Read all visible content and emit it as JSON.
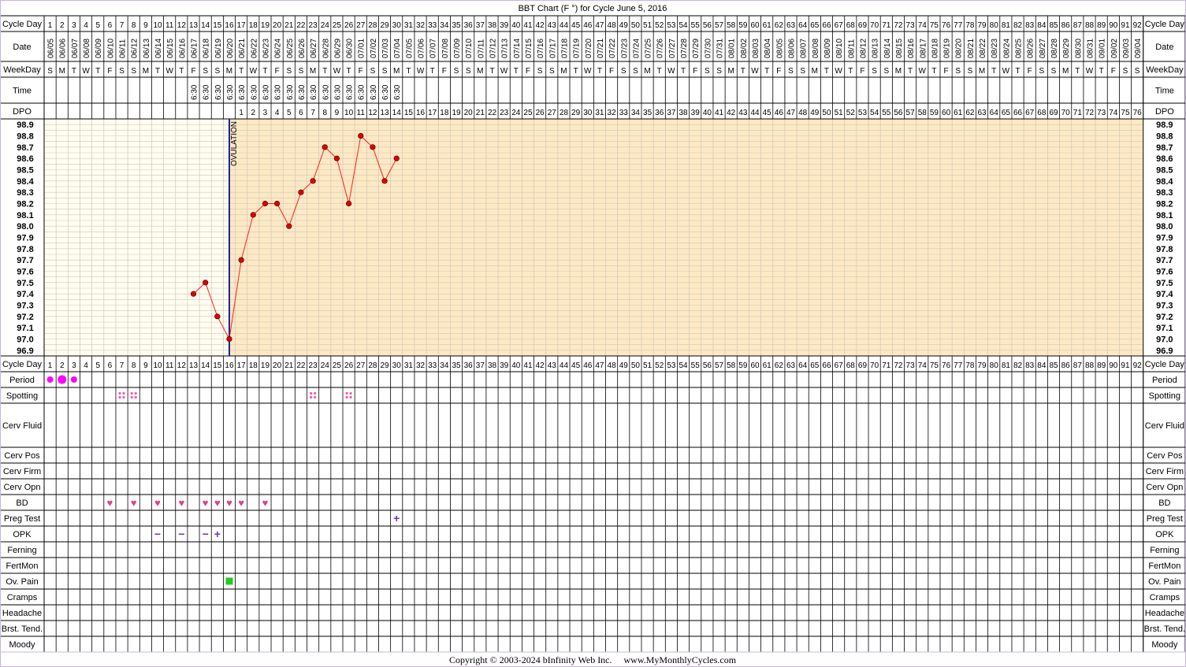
{
  "title": "BBT Chart (F °) for Cycle June 5, 2016",
  "copyright": "Copyright © 2003-2024 bInfinity Web Inc.     www.MyMonthlyCycles.com",
  "colors": {
    "border": "#c8b4e6",
    "pre_ovulation_bg": "#fffdf0",
    "post_ovulation_bg": "#fde9c4",
    "grid": "#cfc8b8",
    "temp_line": "#ff2020",
    "temp_point": "#e00000",
    "ovulation_line": "#2020a0",
    "period": "#ff00ff",
    "spotting": "#ff55aa",
    "bd_heart": "#e0408a",
    "test_mark": "#7030c0",
    "ov_pain": "#22cc22"
  },
  "labels": {
    "cycle_day": "Cycle Day",
    "date": "Date",
    "weekday": "WeekDay",
    "time": "Time",
    "dpo": "DPO",
    "ovulation": "OVULATION"
  },
  "symptom_rows": [
    "Period",
    "Spotting",
    "Cerv Fluid",
    "Cerv Pos",
    "Cerv Firm",
    "Cerv Opn",
    "BD",
    "Preg Test",
    "OPK",
    "Ferning",
    "FertMon",
    "Ov. Pain",
    "Cramps",
    "Headache",
    "Brst. Tend.",
    "Moody"
  ],
  "chart_data": {
    "type": "line",
    "title": "BBT Chart (F °) for Cycle June 5, 2016",
    "cycle_days": [
      1,
      2,
      3,
      4,
      5,
      6,
      7,
      8,
      9,
      10,
      11,
      12,
      13,
      14,
      15,
      16,
      17,
      18,
      19,
      20,
      21,
      22,
      23,
      24,
      25,
      26,
      27,
      28,
      29,
      30,
      31,
      32,
      33,
      34,
      35,
      36,
      37,
      38,
      39,
      40,
      41,
      42,
      43,
      44,
      45,
      46,
      47,
      48,
      49,
      50,
      51,
      52,
      53,
      54,
      55,
      56,
      57,
      58,
      59,
      60,
      61,
      62,
      63,
      64,
      65,
      66,
      67,
      68,
      69,
      70,
      71,
      72,
      73,
      74,
      75,
      76,
      77,
      78,
      79,
      80,
      81,
      82,
      83,
      84,
      85,
      86,
      87,
      88,
      89,
      90,
      91,
      92
    ],
    "dates": [
      "06/05",
      "06/06",
      "06/07",
      "06/08",
      "06/09",
      "06/10",
      "06/11",
      "06/12",
      "06/13",
      "06/14",
      "06/15",
      "06/16",
      "06/17",
      "06/18",
      "06/19",
      "06/20",
      "06/21",
      "06/22",
      "06/23",
      "06/24",
      "06/25",
      "06/26",
      "06/27",
      "06/28",
      "06/29",
      "06/30",
      "07/01",
      "07/02",
      "07/03",
      "07/04",
      "07/05",
      "07/06",
      "07/07",
      "07/08",
      "07/09",
      "07/10",
      "07/11",
      "07/12",
      "07/13",
      "07/14",
      "07/15",
      "07/16",
      "07/17",
      "07/18",
      "07/19",
      "07/20",
      "07/21",
      "07/22",
      "07/23",
      "07/24",
      "07/25",
      "07/26",
      "07/27",
      "07/28",
      "07/29",
      "07/30",
      "07/31",
      "08/01",
      "08/02",
      "08/03",
      "08/04",
      "08/05",
      "08/06",
      "08/07",
      "08/08",
      "08/09",
      "08/10",
      "08/11",
      "08/12",
      "08/13",
      "08/14",
      "08/15",
      "08/16",
      "08/17",
      "08/18",
      "08/19",
      "08/20",
      "08/21",
      "08/22",
      "08/23",
      "08/24",
      "08/25",
      "08/26",
      "08/27",
      "08/28",
      "08/29",
      "08/30",
      "08/31",
      "09/01",
      "09/02",
      "09/03",
      "09/04"
    ],
    "weekdays": [
      "S",
      "M",
      "T",
      "W",
      "T",
      "F",
      "S",
      "S",
      "M",
      "T",
      "W",
      "T",
      "F",
      "S",
      "S",
      "M",
      "T",
      "W",
      "T",
      "F",
      "S",
      "S",
      "M",
      "T",
      "W",
      "T",
      "F",
      "S",
      "S",
      "M",
      "T",
      "W",
      "T",
      "F",
      "S",
      "S",
      "M",
      "T",
      "W",
      "T",
      "F",
      "S",
      "S",
      "M",
      "T",
      "W",
      "T",
      "F",
      "S",
      "S",
      "M",
      "T",
      "W",
      "T",
      "F",
      "S",
      "S",
      "M",
      "T",
      "W",
      "T",
      "F",
      "S",
      "S",
      "M",
      "T",
      "W",
      "T",
      "F",
      "S",
      "S",
      "M",
      "T",
      "W",
      "T",
      "F",
      "S",
      "S",
      "M",
      "T",
      "W",
      "T",
      "F",
      "S",
      "S",
      "M",
      "T",
      "W",
      "T",
      "F",
      "S",
      "S"
    ],
    "times": [
      null,
      null,
      null,
      null,
      null,
      null,
      null,
      null,
      null,
      null,
      null,
      null,
      "6:30",
      "6:30",
      "6:30",
      "6:30",
      "6:30",
      "6:30",
      "6:30",
      "6:30",
      "6:30",
      "6:30",
      "6:30",
      "6:30",
      "6:30",
      "6:30",
      "6:30",
      "6:30",
      "6:30",
      "6:30"
    ],
    "dpo": [
      1,
      2,
      3,
      4,
      5,
      6,
      7,
      8,
      9,
      10,
      11,
      12,
      13,
      14,
      15,
      16,
      17,
      18,
      19,
      20,
      21,
      22,
      23,
      24,
      25,
      26,
      27,
      28,
      29,
      30,
      31,
      32,
      33,
      34,
      35,
      36,
      37,
      38,
      39,
      40,
      41,
      42,
      43,
      44,
      45,
      46,
      47,
      48,
      49,
      50,
      51,
      52,
      53,
      54,
      55,
      56,
      57,
      58,
      59,
      60,
      61,
      62,
      63,
      64,
      65,
      66,
      67,
      68,
      69,
      70,
      71,
      72,
      73,
      74,
      75,
      76
    ],
    "dpo_start_day": 17,
    "temp_axis_labels": [
      "98.9",
      "98.8",
      "98.7",
      "98.6",
      "98.5",
      "98.4",
      "98.3",
      "98.2",
      "98.1",
      "98.0",
      "97.9",
      "97.8",
      "97.7",
      "97.6",
      "97.5",
      "97.4",
      "97.3",
      "97.2",
      "97.1",
      "97.0",
      "96.9"
    ],
    "ylim": [
      96.9,
      98.9
    ],
    "temperatures": [
      {
        "day": 13,
        "temp": 97.4
      },
      {
        "day": 14,
        "temp": 97.5
      },
      {
        "day": 15,
        "temp": 97.2
      },
      {
        "day": 16,
        "temp": 97.0
      },
      {
        "day": 17,
        "temp": 97.7
      },
      {
        "day": 18,
        "temp": 98.1
      },
      {
        "day": 19,
        "temp": 98.2
      },
      {
        "day": 20,
        "temp": 98.2
      },
      {
        "day": 21,
        "temp": 98.0
      },
      {
        "day": 22,
        "temp": 98.3
      },
      {
        "day": 23,
        "temp": 98.4
      },
      {
        "day": 24,
        "temp": 98.7
      },
      {
        "day": 25,
        "temp": 98.6
      },
      {
        "day": 26,
        "temp": 98.2
      },
      {
        "day": 27,
        "temp": 98.8
      },
      {
        "day": 28,
        "temp": 98.7
      },
      {
        "day": 29,
        "temp": 98.4
      },
      {
        "day": 30,
        "temp": 98.6
      }
    ],
    "ovulation_day": 16,
    "period_days": [
      {
        "day": 1,
        "size": "medium"
      },
      {
        "day": 2,
        "size": "large"
      },
      {
        "day": 3,
        "size": "medium"
      }
    ],
    "spotting_days": [
      7,
      8,
      23,
      26
    ],
    "bd_days": [
      6,
      8,
      10,
      12,
      14,
      15,
      16,
      17,
      19
    ],
    "preg_test": [
      {
        "day": 30,
        "result": "+"
      }
    ],
    "opk": [
      {
        "day": 10,
        "result": "−"
      },
      {
        "day": 12,
        "result": "−"
      },
      {
        "day": 14,
        "result": "−"
      },
      {
        "day": 15,
        "result": "+"
      }
    ],
    "ov_pain_days": [
      16
    ]
  }
}
